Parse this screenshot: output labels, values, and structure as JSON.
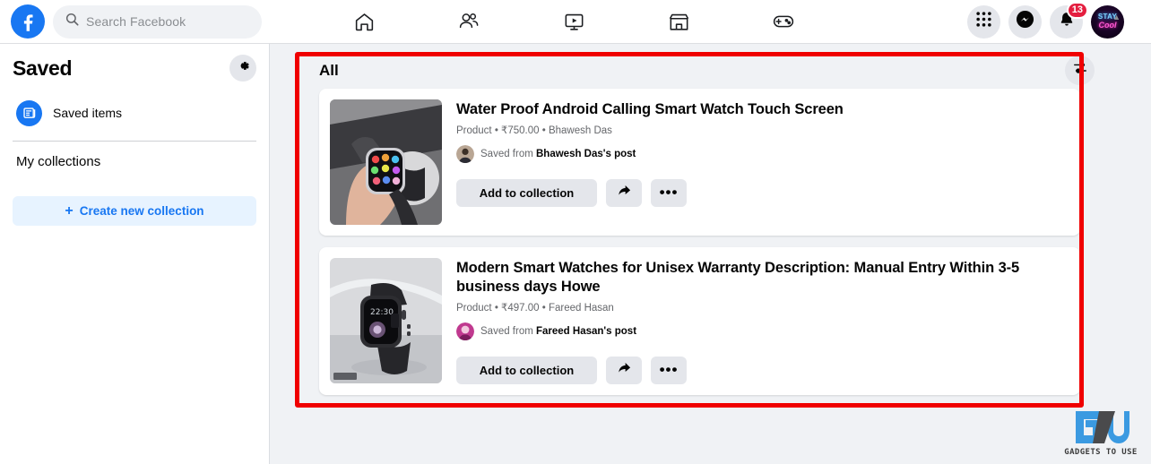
{
  "topbar": {
    "logo_icon": "facebook-logo-icon",
    "search": {
      "placeholder": "Search Facebook",
      "icon": "search-icon"
    },
    "nav": [
      {
        "name": "home",
        "icon": "home-icon"
      },
      {
        "name": "friends",
        "icon": "friends-icon"
      },
      {
        "name": "watch",
        "icon": "video-play-icon"
      },
      {
        "name": "marketplace",
        "icon": "marketplace-store-icon"
      },
      {
        "name": "gaming",
        "icon": "gaming-controller-icon"
      }
    ],
    "right": {
      "menu_icon": "grid-menu-icon",
      "messenger_icon": "messenger-icon",
      "notifications_icon": "bell-icon",
      "notifications_count": "13",
      "avatar_line1": "STAY",
      "avatar_line2": "Cool"
    }
  },
  "sidebar": {
    "title": "Saved",
    "settings_icon": "gear-icon",
    "items": [
      {
        "label": "Saved items",
        "icon": "saved-items-icon"
      }
    ],
    "section_label": "My collections",
    "create_button": {
      "label": "Create new collection",
      "plus": "+"
    }
  },
  "main": {
    "heading": "All",
    "filter_icon": "filter-settings-icon",
    "saved_items": [
      {
        "title": "Water Proof Android Calling Smart Watch Touch Screen",
        "meta": "Product • ₹750.00 • Bhawesh Das",
        "saved_from_prefix": "Saved from ",
        "saved_from_name": "Bhawesh Das's post",
        "thumbnail_alt": "hand-holding-smartwatch-photo",
        "actions": {
          "add_label": "Add to collection",
          "share_icon": "share-arrow-icon",
          "more_label": "•••"
        }
      },
      {
        "title": "Modern Smart Watches for Unisex Warranty Description: Manual Entry Within 3-5 business days Howe",
        "meta": "Product • ₹497.00 • Fareed Hasan",
        "saved_from_prefix": "Saved from ",
        "saved_from_name": "Fareed Hasan's post",
        "thumbnail_alt": "black-smartwatch-product-photo",
        "thumbnail_time": "22:30",
        "actions": {
          "add_label": "Add to collection",
          "share_icon": "share-arrow-icon",
          "more_label": "•••"
        }
      }
    ]
  },
  "watermark": {
    "text": "GADGETS TO USE"
  },
  "colors": {
    "brand_blue": "#1877f2",
    "page_bg": "#f0f2f5",
    "card_bg": "#ffffff",
    "button_grey": "#e4e6eb",
    "annotation_red": "#f00000",
    "badge_red": "#e41e3f"
  }
}
